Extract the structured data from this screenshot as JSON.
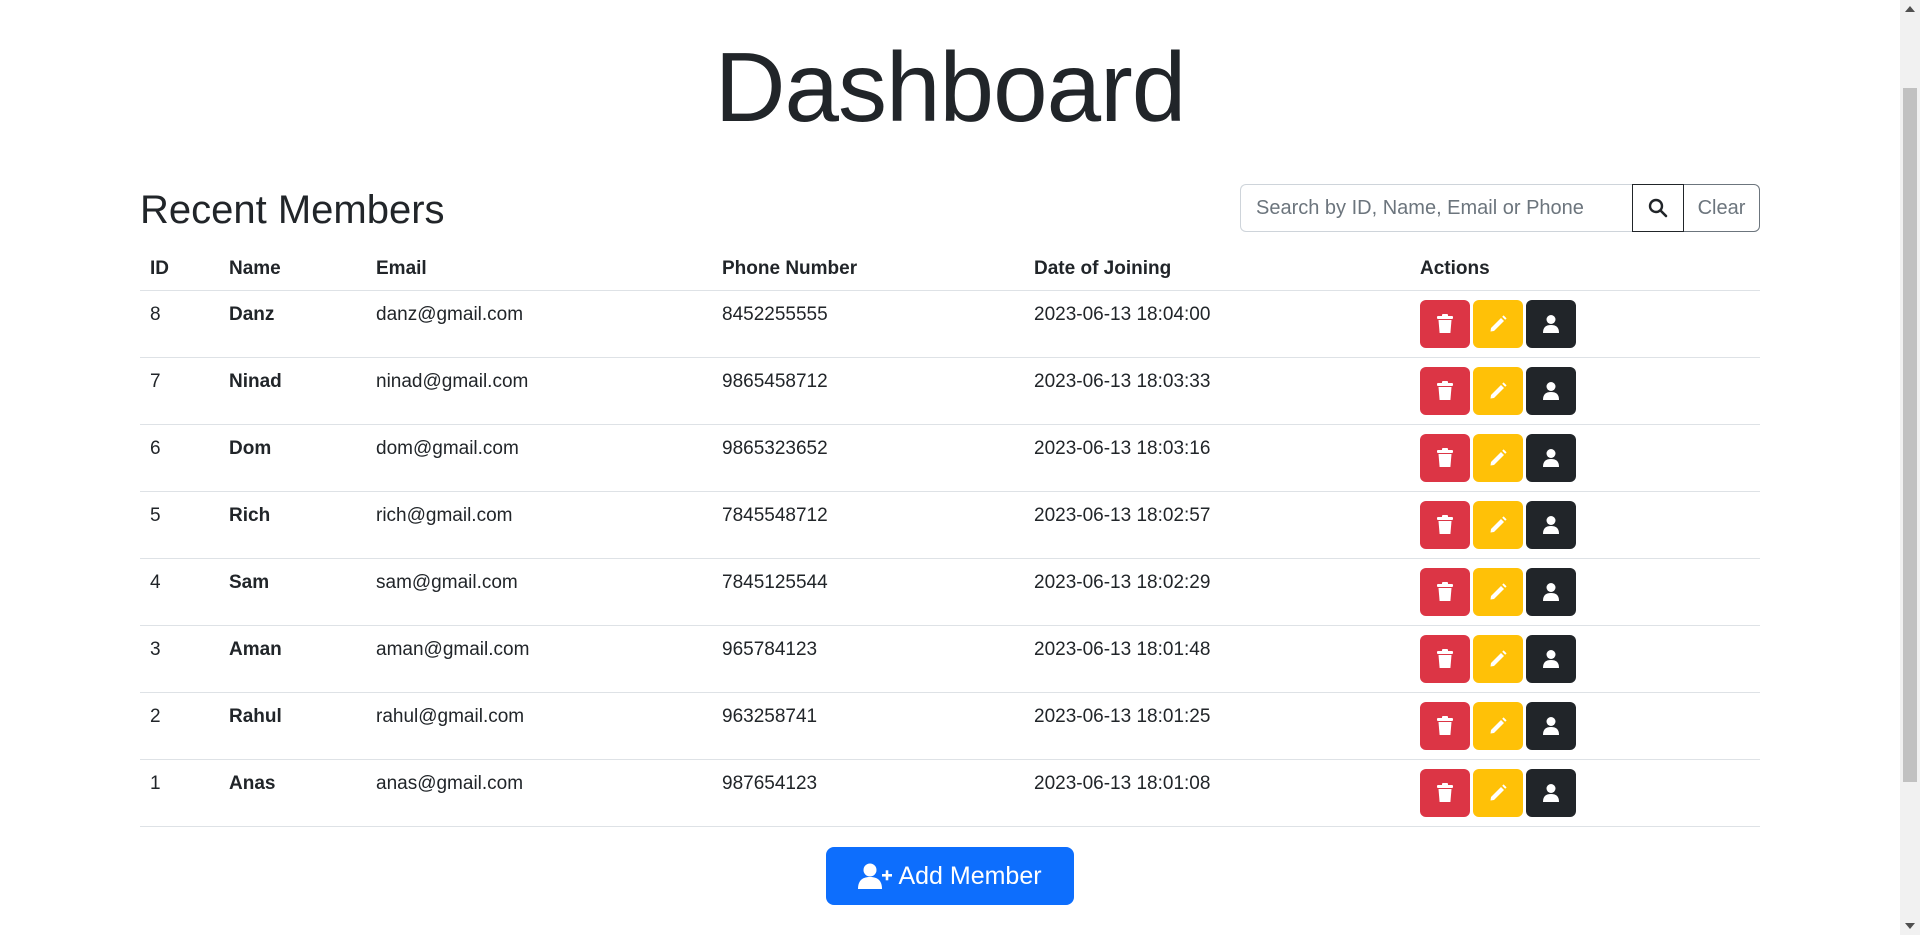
{
  "page": {
    "title": "Dashboard"
  },
  "section": {
    "title": "Recent Members"
  },
  "search": {
    "placeholder": "Search by ID, Name, Email or Phone",
    "value": "",
    "clear_label": "Clear"
  },
  "table": {
    "headers": [
      "ID",
      "Name",
      "Email",
      "Phone Number",
      "Date of Joining",
      "Actions"
    ],
    "rows": [
      {
        "id": "8",
        "name": "Danz",
        "email": "danz@gmail.com",
        "phone": "8452255555",
        "joined": "2023-06-13 18:04:00"
      },
      {
        "id": "7",
        "name": "Ninad",
        "email": "ninad@gmail.com",
        "phone": "9865458712",
        "joined": "2023-06-13 18:03:33"
      },
      {
        "id": "6",
        "name": "Dom",
        "email": "dom@gmail.com",
        "phone": "9865323652",
        "joined": "2023-06-13 18:03:16"
      },
      {
        "id": "5",
        "name": "Rich",
        "email": "rich@gmail.com",
        "phone": "7845548712",
        "joined": "2023-06-13 18:02:57"
      },
      {
        "id": "4",
        "name": "Sam",
        "email": "sam@gmail.com",
        "phone": "7845125544",
        "joined": "2023-06-13 18:02:29"
      },
      {
        "id": "3",
        "name": "Aman",
        "email": "aman@gmail.com",
        "phone": "965784123",
        "joined": "2023-06-13 18:01:48"
      },
      {
        "id": "2",
        "name": "Rahul",
        "email": "rahul@gmail.com",
        "phone": "963258741",
        "joined": "2023-06-13 18:01:25"
      },
      {
        "id": "1",
        "name": "Anas",
        "email": "anas@gmail.com",
        "phone": "987654123",
        "joined": "2023-06-13 18:01:08"
      }
    ],
    "row_actions": [
      "trash-icon",
      "pencil-icon",
      "user-icon"
    ]
  },
  "add_button": {
    "label": "Add Member",
    "icon": "user-plus-icon"
  },
  "colors": {
    "danger": "#dc3545",
    "warning": "#ffc107",
    "dark": "#212529",
    "primary": "#0d6efd"
  }
}
